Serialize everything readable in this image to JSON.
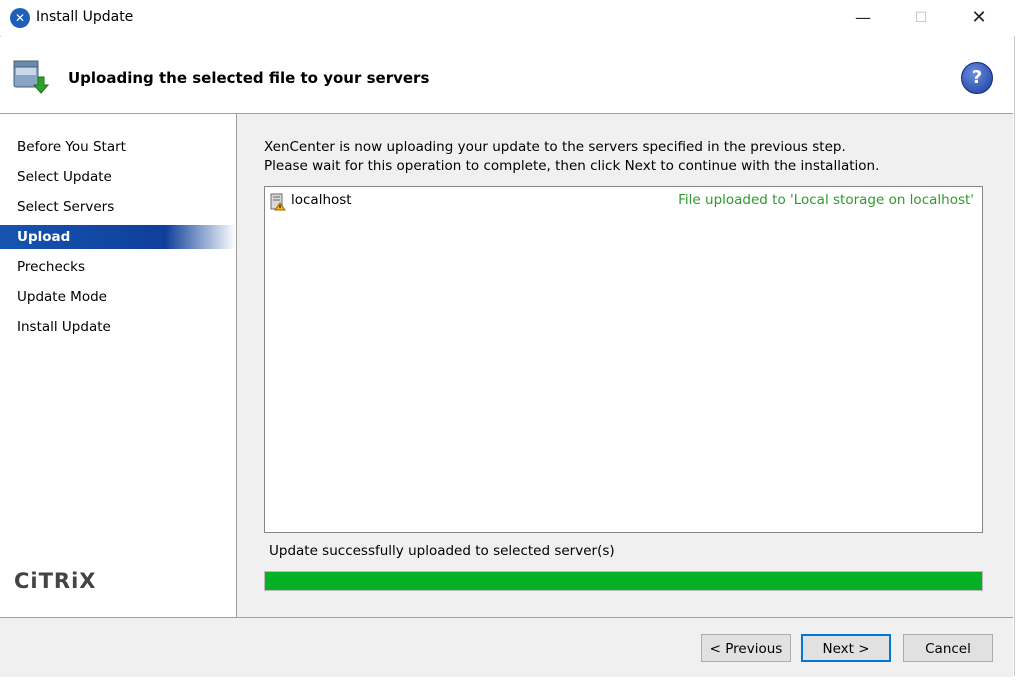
{
  "window": {
    "title": "Install Update",
    "minimize_glyph": "—",
    "maximize_glyph": "☐",
    "close_glyph": "✕"
  },
  "header": {
    "title": "Uploading the selected file to your servers",
    "help_glyph": "?"
  },
  "sidebar": {
    "items": [
      {
        "label": "Before You Start",
        "active": false
      },
      {
        "label": "Select Update",
        "active": false
      },
      {
        "label": "Select Servers",
        "active": false
      },
      {
        "label": "Upload",
        "active": true
      },
      {
        "label": "Prechecks",
        "active": false
      },
      {
        "label": "Update Mode",
        "active": false
      },
      {
        "label": "Install Update",
        "active": false
      }
    ],
    "brand": "CiTRiX"
  },
  "main": {
    "intro_line1": "XenCenter is now uploading your update to the servers specified in the previous step.",
    "intro_line2": "Please wait for this operation to complete, then click Next to continue with the installation.",
    "servers": [
      {
        "name": "localhost",
        "status": "File uploaded to 'Local storage on localhost'",
        "icon": "server-warning-icon"
      }
    ],
    "status_text": "Update successfully uploaded to selected server(s)",
    "progress_percent": 100,
    "status_color": "#2e9a2e",
    "progress_color": "#06b025"
  },
  "footer": {
    "previous_label": "< Previous",
    "next_label": "Next >",
    "cancel_label": "Cancel"
  }
}
